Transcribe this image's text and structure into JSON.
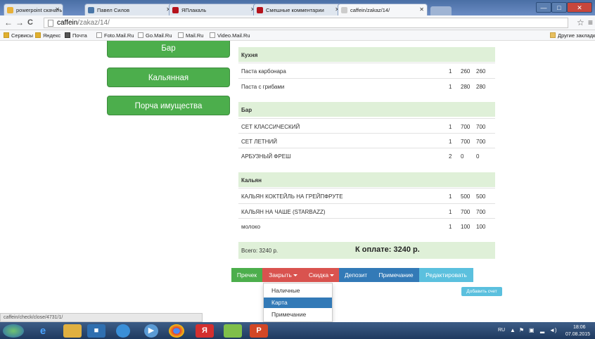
{
  "tabs": [
    {
      "title": "powerpoint скачать бесп",
      "icon": "yandex-icon",
      "color": "#e8b13a"
    },
    {
      "title": "Павел Силов",
      "icon": "vk-icon",
      "color": "#4a76a8"
    },
    {
      "title": "ЯПлакаль",
      "icon": "yaplakal-icon",
      "color": "#b5121b"
    },
    {
      "title": "Смешные комментарии",
      "icon": "yaplakal-icon",
      "color": "#b5121b"
    },
    {
      "title": "caffein/zakaz/14/",
      "icon": "page-icon",
      "color": "#cccccc"
    }
  ],
  "window": {
    "minimize": "—",
    "maximize": "□",
    "close": "✕"
  },
  "nav": {
    "back": "←",
    "forward": "→",
    "reload": "C",
    "star": "☆",
    "menu": "≡"
  },
  "address": {
    "host": "caffein",
    "path": "/zakaz/14/"
  },
  "bookmarks": [
    {
      "label": "Сервисы"
    },
    {
      "label": "Яндекс"
    },
    {
      "label": "Почта"
    },
    {
      "label": "Foto.Mail.Ru"
    },
    {
      "label": "Go.Mail.Ru"
    },
    {
      "label": "Mail.Ru"
    },
    {
      "label": "Video.Mail.Ru"
    }
  ],
  "other_bookmarks": "Другие закладк",
  "menu": {
    "bar": "Бар",
    "hookah": "Кальянная",
    "damage": "Порча имущества"
  },
  "sections": {
    "kitchen": {
      "title": "Кухня",
      "items": [
        {
          "name": "Паста карбонара",
          "qty": "1",
          "price": "260",
          "total": "260"
        },
        {
          "name": "Паста с грибами",
          "qty": "1",
          "price": "280",
          "total": "280"
        }
      ]
    },
    "bar": {
      "title": "Бар",
      "items": [
        {
          "name": "СЕТ КЛАССИЧЕСКИЙ",
          "qty": "1",
          "price": "700",
          "total": "700"
        },
        {
          "name": "СЕТ ЛЕТНИЙ",
          "qty": "1",
          "price": "700",
          "total": "700"
        },
        {
          "name": "АРБУЗНЫЙ ФРЕШ",
          "qty": "2",
          "price": "0",
          "total": "0"
        }
      ]
    },
    "hookah": {
      "title": "Кальян",
      "items": [
        {
          "name": "КАЛЬЯН КОКТЕЙЛЬ НА ГРЕЙПФРУТЕ",
          "qty": "1",
          "price": "500",
          "total": "500"
        },
        {
          "name": "КАЛЬЯН НА ЧАШЕ (STARBAZZ)",
          "qty": "1",
          "price": "700",
          "total": "700"
        },
        {
          "name": "молоко",
          "qty": "1",
          "price": "100",
          "total": "100"
        }
      ]
    }
  },
  "totals": {
    "all": "Всего: 3240 р.",
    "pay": "К оплате: 3240 р."
  },
  "actions": {
    "receipt": "Пречек",
    "close": "Закрыть",
    "discount": "Скидка",
    "deposit": "Депозит",
    "note": "Примечание",
    "edit": "Редактировать"
  },
  "close_dropdown": {
    "cash": "Наличные",
    "card": "Карта",
    "note": "Примечание"
  },
  "add_bill": "Добавить счет",
  "status_url": "caffein/check/close/4731/1/",
  "tray": {
    "lang": "RU",
    "time": "18:06",
    "date": "07.08.2015"
  },
  "colors": {
    "green": "#4cae4c",
    "red": "#d9534f",
    "blue": "#337ab7",
    "light_blue": "#5bc0de",
    "section_bg": "#dff0d8"
  }
}
